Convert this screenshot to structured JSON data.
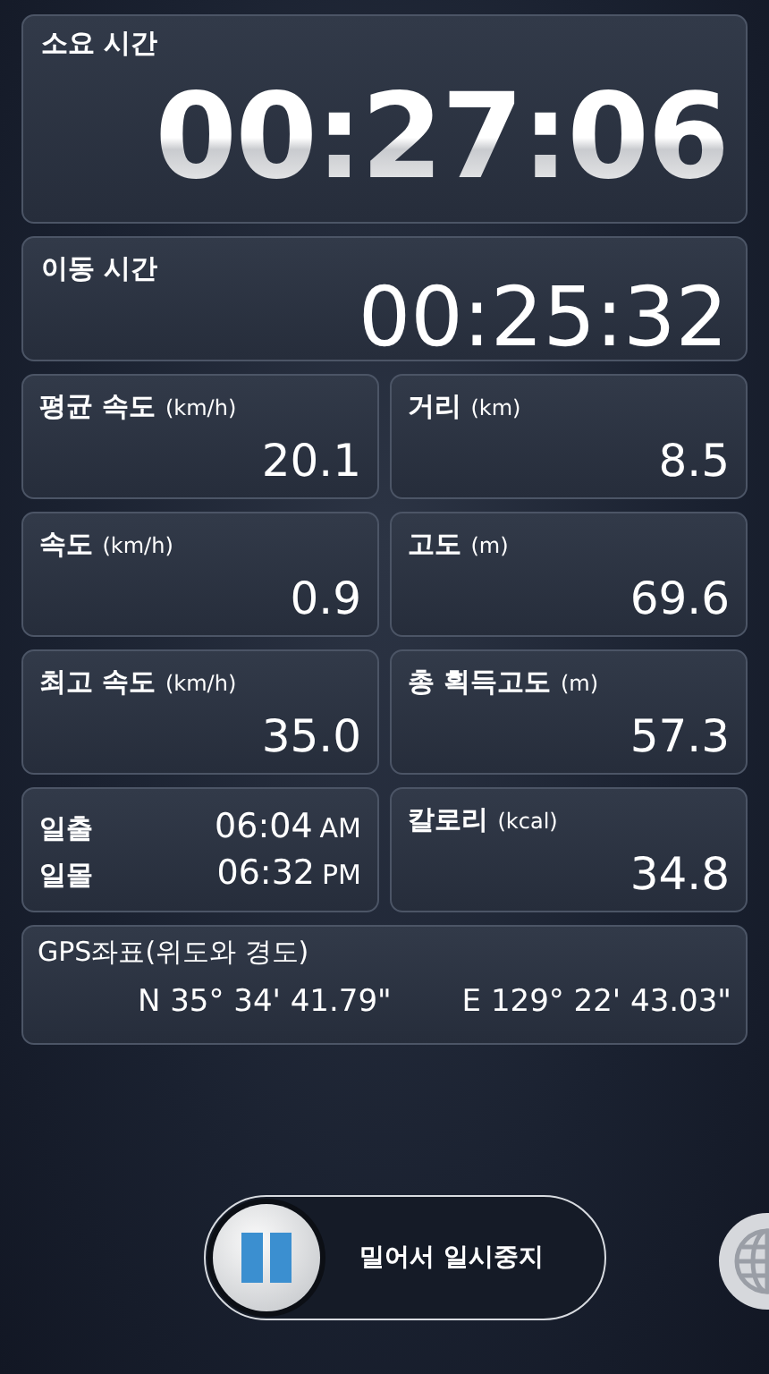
{
  "total_time": {
    "label": "소요 시간",
    "value": "00:27:06"
  },
  "moving_time": {
    "label": "이동 시간",
    "value": "00:25:32"
  },
  "stats": [
    {
      "kind": "metric",
      "label": "평균 속도",
      "unit": "(km/h)",
      "value": "20.1"
    },
    {
      "kind": "metric",
      "label": "거리",
      "unit": "(km)",
      "value": "8.5"
    },
    {
      "kind": "metric",
      "label": "속도",
      "unit": "(km/h)",
      "value": "0.9"
    },
    {
      "kind": "metric",
      "label": "고도",
      "unit": "(m)",
      "value": "69.6"
    },
    {
      "kind": "metric",
      "label": "최고 속도",
      "unit": "(km/h)",
      "value": "35.0"
    },
    {
      "kind": "metric",
      "label": "총 획득고도",
      "unit": "(m)",
      "value": "57.3"
    },
    {
      "kind": "sun",
      "rows": [
        {
          "label": "일출",
          "time": "06:04",
          "period": "AM"
        },
        {
          "label": "일몰",
          "time": "06:32",
          "period": "PM"
        }
      ]
    },
    {
      "kind": "metric",
      "label": "칼로리",
      "unit": "(kcal)",
      "value": "34.8"
    }
  ],
  "gps": {
    "label": "GPS좌표(위도와 경도)",
    "latitude": "N 35° 34' 41.79\"",
    "longitude": "E 129° 22' 43.03\""
  },
  "pause_slider": {
    "label": "밀어서 일시중지",
    "level": 0
  }
}
